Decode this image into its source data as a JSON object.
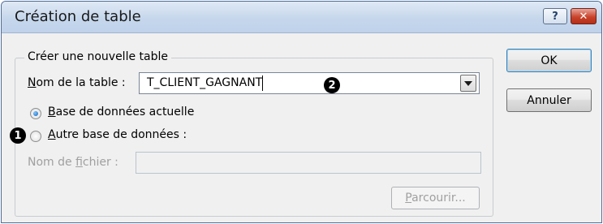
{
  "dialog": {
    "title": "Création de table",
    "help_glyph": "?",
    "close_glyph": "✕"
  },
  "group": {
    "label": "Créer une nouvelle table"
  },
  "table_name": {
    "label": "Nom de la table :",
    "value": "T_CLIENT_GAGNANT"
  },
  "options": {
    "current_db": "Base de données actuelle",
    "other_db": "Autre base de données :",
    "selected": "current_db"
  },
  "file_name": {
    "label": "Nom de fichier :",
    "value": ""
  },
  "buttons": {
    "ok": "OK",
    "cancel": "Annuler",
    "browse": "Parcourir..."
  },
  "markers": {
    "one": "1",
    "two": "2"
  }
}
